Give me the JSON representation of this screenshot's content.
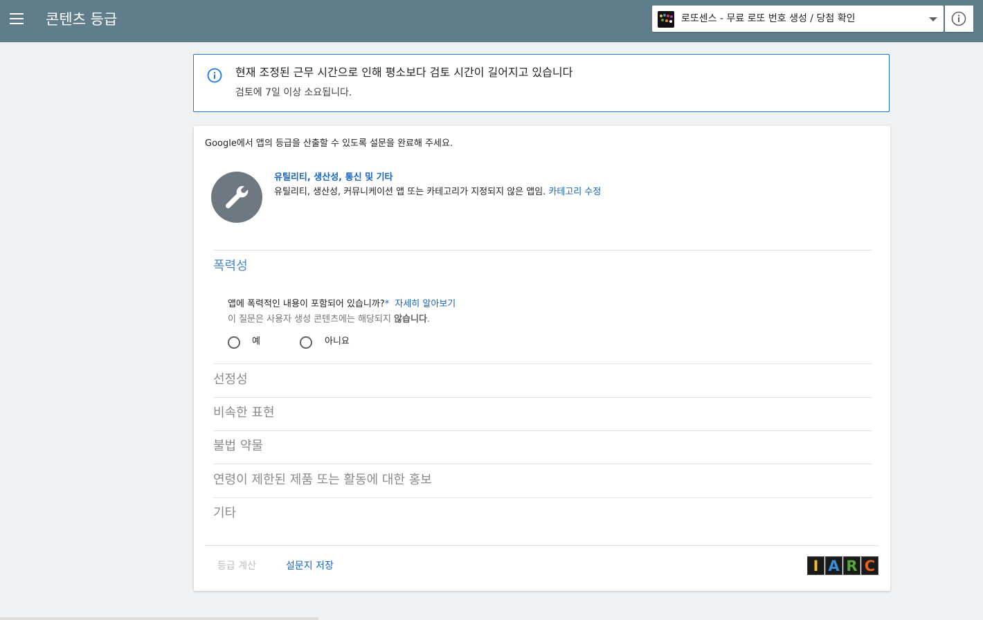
{
  "header": {
    "title": "콘텐츠 등급",
    "app_name": "로또센스 - 무료 로또 번호 생성 / 당첨 확인",
    "icons": {
      "menu": "menu-icon",
      "dropdown": "chevron-down-icon",
      "help": "info-icon"
    }
  },
  "notice": {
    "title": "현재 조정된 근무 시간으로 인해 평소보다 검토 시간이 길어지고 있습니다",
    "subtitle": "검토에 7일 이상 소요됩니다.",
    "accent": "#1a73e8"
  },
  "card": {
    "intro": "Google에서 앱의 등급을 산출할 수 있도록 설문을 완료해 주세요.",
    "category": {
      "title": "유틸리티, 생산성, 통신 및 기타",
      "description": "유틸리티, 생산성, 커뮤니케이션 앱 또는 카테고리가 지정되지 않은 앱임.",
      "edit_label": "카테고리 수정",
      "icon": "wrench-icon"
    },
    "sections": [
      {
        "label": "폭력성",
        "active": true
      },
      {
        "label": "선정성",
        "active": false
      },
      {
        "label": "비속한 표현",
        "active": false
      },
      {
        "label": "불법 약물",
        "active": false
      },
      {
        "label": "연령이 제한된 제품 또는 활동에 대한 홍보",
        "active": false
      },
      {
        "label": "기타",
        "active": false
      }
    ],
    "question": {
      "text": "앱에 폭력적인 내용이 포함되어 있습니까?",
      "required_mark": "*",
      "learn_more": "자세히 알아보기",
      "note_prefix": "이 질문은 사용자 생성 콘텐츠에는 해당되지 ",
      "note_bold": "않습니다",
      "note_suffix": ".",
      "options": [
        "예",
        "아니요"
      ]
    },
    "footer": {
      "calculate_label": "등급 계산",
      "save_label": "설문지 저장",
      "iarc_letters": [
        "I",
        "A",
        "R",
        "C"
      ],
      "iarc_colors": [
        "#f2c417",
        "#3b8fd9",
        "#54a83c",
        "#e4611d"
      ]
    }
  },
  "colors": {
    "topbar": "#607d8b",
    "link": "#1565c0",
    "background": "#f0f1f2"
  }
}
